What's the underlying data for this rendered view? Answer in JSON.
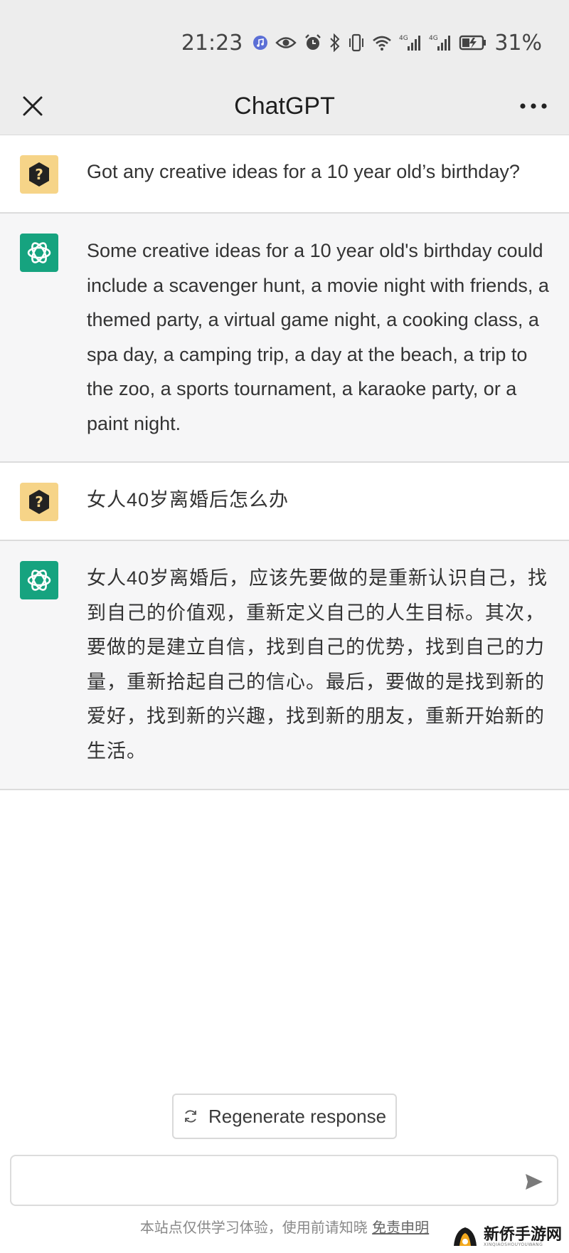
{
  "status_bar": {
    "time": "21:23",
    "battery": "31%",
    "icons": [
      "music-app-icon",
      "eye-icon",
      "alarm-icon",
      "bluetooth-icon",
      "vibrate-icon",
      "wifi-icon",
      "signal-4g-icon",
      "signal-4g-icon",
      "battery-icon"
    ]
  },
  "header": {
    "title": "ChatGPT",
    "close_icon": "close-icon",
    "more_icon": "more-dots-icon"
  },
  "messages": [
    {
      "role": "user",
      "text": "Got any creative ideas for a 10 year old’s birthday?"
    },
    {
      "role": "assistant",
      "text": "Some creative ideas for a 10 year old's birthday could include a scavenger hunt, a movie night with friends, a themed party, a virtual game night, a cooking class, a spa day, a camping trip, a day at the beach, a trip to the zoo, a sports tournament, a karaoke party, or a paint night."
    },
    {
      "role": "user",
      "text": "女人40岁离婚后怎么办"
    },
    {
      "role": "assistant",
      "text": "女人40岁离婚后，应该先要做的是重新认识自己，找到自己的价值观，重新定义自己的人生目标。其次，要做的是建立自信，找到自己的优势，找到自己的力量，重新拾起自己的信心。最后，要做的是找到新的爱好，找到新的兴趣，找到新的朋友，重新开始新的生活。"
    }
  ],
  "regenerate": {
    "label": "Regenerate response",
    "icon": "refresh-icon"
  },
  "composer": {
    "value": "",
    "placeholder": "",
    "send_icon": "send-icon"
  },
  "footer": {
    "note": "本站点仅供学习体验，使用前请知晓",
    "link": "免责申明"
  },
  "watermark": {
    "main": "新侨手游网",
    "sub": "XINQIAOSHOUYOUWANG"
  },
  "colors": {
    "user_avatar": "#f6d488",
    "bot_avatar": "#16a37f",
    "bot_bg": "#f6f6f7",
    "header_bg": "#ededed"
  }
}
